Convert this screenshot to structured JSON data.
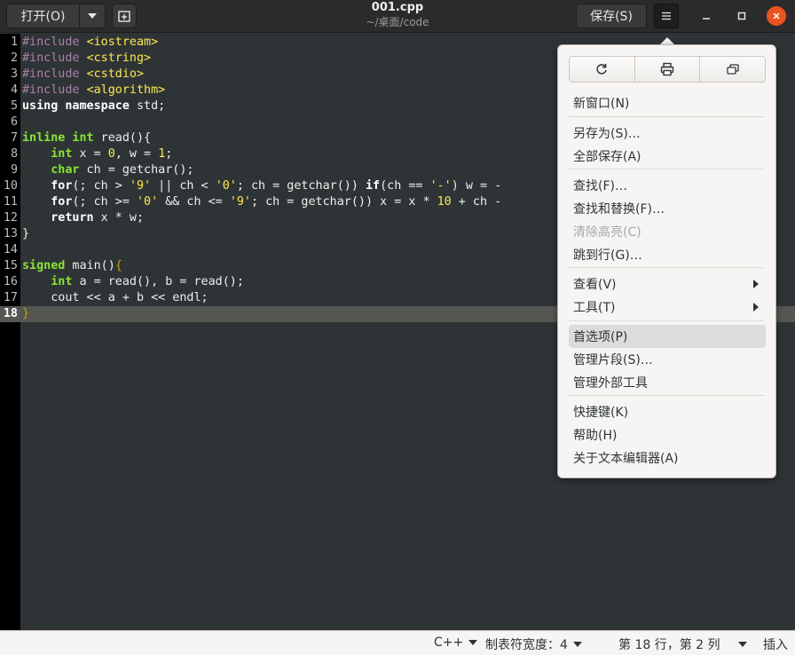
{
  "header": {
    "open_label": "打开(O)",
    "title": "001.cpp",
    "subtitle": "~/桌面/code",
    "save_label": "保存(S)"
  },
  "editor": {
    "current_line": 18,
    "lines": [
      {
        "n": "1",
        "tokens": [
          {
            "t": "#include ",
            "c": "pp"
          },
          {
            "t": "<iostream>",
            "c": "inc"
          }
        ]
      },
      {
        "n": "2",
        "tokens": [
          {
            "t": "#include ",
            "c": "pp"
          },
          {
            "t": "<cstring>",
            "c": "inc"
          }
        ]
      },
      {
        "n": "3",
        "tokens": [
          {
            "t": "#include ",
            "c": "pp"
          },
          {
            "t": "<cstdio>",
            "c": "inc"
          }
        ]
      },
      {
        "n": "4",
        "tokens": [
          {
            "t": "#include ",
            "c": "pp"
          },
          {
            "t": "<algorithm>",
            "c": "inc"
          }
        ]
      },
      {
        "n": "5",
        "tokens": [
          {
            "t": "using namespace",
            "c": "bold"
          },
          {
            "t": " std;",
            "c": ""
          }
        ]
      },
      {
        "n": "6",
        "tokens": []
      },
      {
        "n": "7",
        "tokens": [
          {
            "t": "inline int",
            "c": "kw"
          },
          {
            "t": " read(){",
            "c": ""
          }
        ]
      },
      {
        "n": "8",
        "tokens": [
          {
            "t": "    ",
            "c": ""
          },
          {
            "t": "int",
            "c": "kw"
          },
          {
            "t": " x = ",
            "c": ""
          },
          {
            "t": "0",
            "c": "num"
          },
          {
            "t": ", w = ",
            "c": ""
          },
          {
            "t": "1",
            "c": "num"
          },
          {
            "t": ";",
            "c": ""
          }
        ]
      },
      {
        "n": "9",
        "tokens": [
          {
            "t": "    ",
            "c": ""
          },
          {
            "t": "char",
            "c": "kw"
          },
          {
            "t": " ch = getchar();",
            "c": ""
          }
        ]
      },
      {
        "n": "10",
        "tokens": [
          {
            "t": "    ",
            "c": ""
          },
          {
            "t": "for",
            "c": "bold"
          },
          {
            "t": "(; ch > ",
            "c": ""
          },
          {
            "t": "'9'",
            "c": "str"
          },
          {
            "t": " || ch < ",
            "c": ""
          },
          {
            "t": "'0'",
            "c": "str"
          },
          {
            "t": "; ch = getchar()) ",
            "c": ""
          },
          {
            "t": "if",
            "c": "bold"
          },
          {
            "t": "(ch == ",
            "c": ""
          },
          {
            "t": "'-'",
            "c": "str"
          },
          {
            "t": ") w = -",
            "c": ""
          }
        ]
      },
      {
        "n": "11",
        "tokens": [
          {
            "t": "    ",
            "c": ""
          },
          {
            "t": "for",
            "c": "bold"
          },
          {
            "t": "(; ch >= ",
            "c": ""
          },
          {
            "t": "'0'",
            "c": "str"
          },
          {
            "t": " && ch <= ",
            "c": ""
          },
          {
            "t": "'9'",
            "c": "str"
          },
          {
            "t": "; ch = getchar()) x = x * ",
            "c": ""
          },
          {
            "t": "10",
            "c": "num"
          },
          {
            "t": " + ch -",
            "c": ""
          }
        ]
      },
      {
        "n": "12",
        "tokens": [
          {
            "t": "    ",
            "c": ""
          },
          {
            "t": "return",
            "c": "bold"
          },
          {
            "t": " x * w;",
            "c": ""
          }
        ]
      },
      {
        "n": "13",
        "tokens": [
          {
            "t": "}",
            "c": ""
          }
        ]
      },
      {
        "n": "14",
        "tokens": []
      },
      {
        "n": "15",
        "tokens": [
          {
            "t": "signed",
            "c": "kw"
          },
          {
            "t": " main()",
            "c": ""
          },
          {
            "t": "{",
            "c": "brace"
          }
        ]
      },
      {
        "n": "16",
        "tokens": [
          {
            "t": "    ",
            "c": ""
          },
          {
            "t": "int",
            "c": "kw"
          },
          {
            "t": " a = read(), b = read();",
            "c": ""
          }
        ]
      },
      {
        "n": "17",
        "tokens": [
          {
            "t": "    cout << a + b << endl;",
            "c": ""
          }
        ]
      },
      {
        "n": "18",
        "tokens": [
          {
            "t": "}",
            "c": "brace"
          }
        ]
      }
    ]
  },
  "menu": {
    "icons": [
      "reload-icon",
      "print-icon",
      "fullscreen-icon"
    ],
    "items": [
      {
        "label": "新窗口(N)",
        "name": "menu-new-window",
        "state": "normal"
      },
      {
        "label": "另存为(S)…",
        "name": "menu-save-as",
        "state": "normal"
      },
      {
        "label": "全部保存(A)",
        "name": "menu-save-all",
        "state": "normal"
      },
      {
        "label": "查找(F)…",
        "name": "menu-find",
        "state": "normal"
      },
      {
        "label": "查找和替换(F)…",
        "name": "menu-find-replace",
        "state": "normal"
      },
      {
        "label": "清除高亮(C)",
        "name": "menu-clear-highlight",
        "state": "disabled"
      },
      {
        "label": "跳到行(G)…",
        "name": "menu-go-to-line",
        "state": "normal"
      },
      {
        "label": "查看(V)",
        "name": "menu-view",
        "state": "submenu"
      },
      {
        "label": "工具(T)",
        "name": "menu-tools",
        "state": "submenu"
      },
      {
        "label": "首选项(P)",
        "name": "menu-preferences",
        "state": "hover"
      },
      {
        "label": "管理片段(S)…",
        "name": "menu-manage-snippets",
        "state": "normal"
      },
      {
        "label": "管理外部工具",
        "name": "menu-manage-external-tools",
        "state": "normal"
      },
      {
        "label": "快捷键(K)",
        "name": "menu-shortcuts",
        "state": "normal"
      },
      {
        "label": "帮助(H)",
        "name": "menu-help",
        "state": "normal"
      },
      {
        "label": "关于文本编辑器(A)",
        "name": "menu-about",
        "state": "normal"
      }
    ]
  },
  "statusbar": {
    "language": "C++",
    "tab_width": "制表符宽度：4",
    "position": "第 18 行，第 2 列",
    "mode": "插入"
  },
  "colors": {
    "accent": "#e95420",
    "editor_bg": "#2e3436",
    "keyword": "#8ae234",
    "string": "#fce94f",
    "preprocessor": "#ad7fa8"
  }
}
